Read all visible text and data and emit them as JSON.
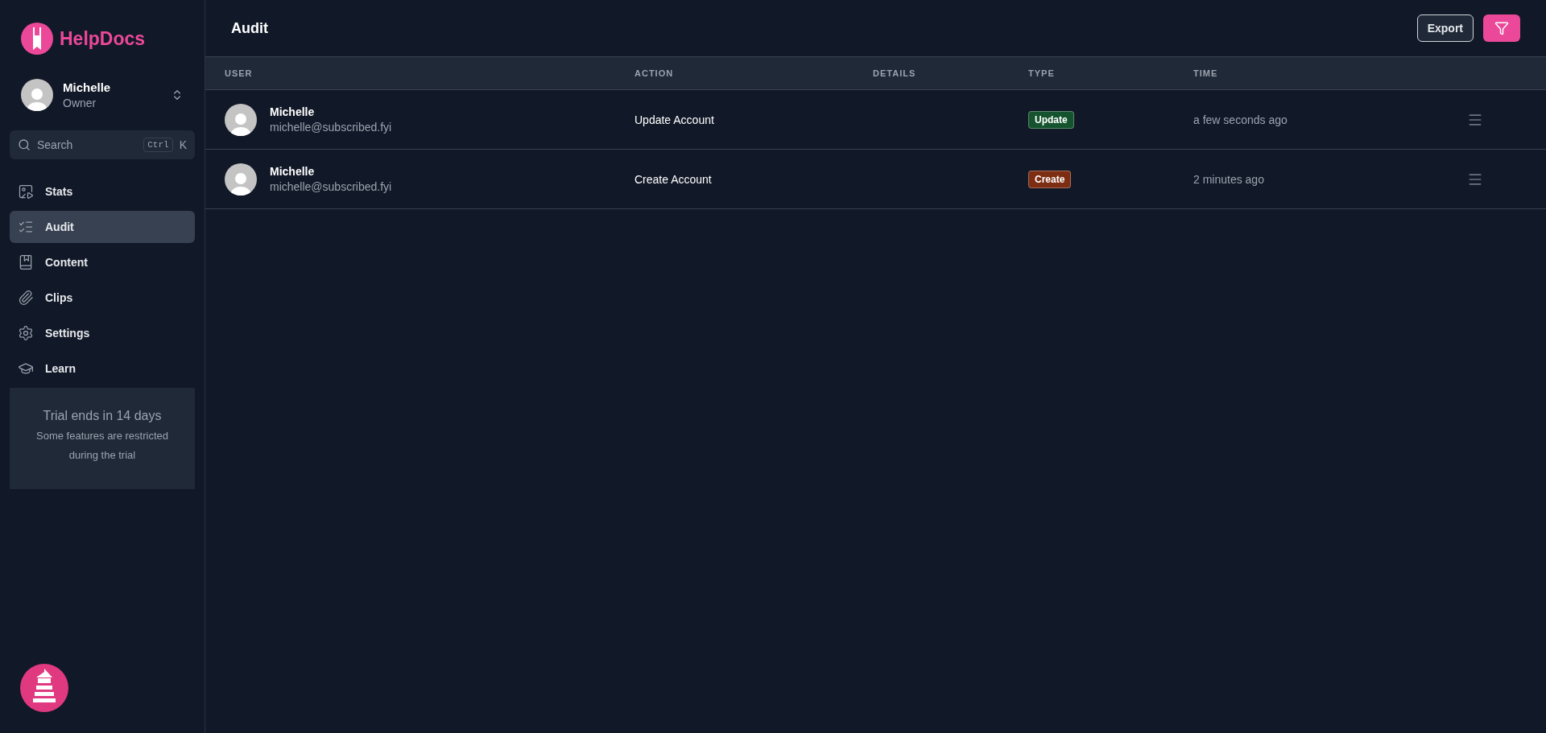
{
  "brand": {
    "name": "HelpDocs"
  },
  "account": {
    "name": "Michelle",
    "role": "Owner"
  },
  "search": {
    "placeholder": "Search",
    "shortcut": [
      "Ctrl",
      "K"
    ]
  },
  "nav": [
    {
      "label": "Stats",
      "selected": false
    },
    {
      "label": "Audit",
      "selected": true
    },
    {
      "label": "Content",
      "selected": false
    },
    {
      "label": "Clips",
      "selected": false
    },
    {
      "label": "Settings",
      "selected": false
    },
    {
      "label": "Learn",
      "selected": false
    }
  ],
  "trial": {
    "title": "Trial ends in 14 days",
    "text": "Some features are restricted during the trial"
  },
  "page": {
    "title": "Audit",
    "export": "Export"
  },
  "table": {
    "columns": [
      "USER",
      "ACTION",
      "DETAILS",
      "TYPE",
      "TIME"
    ],
    "rows": [
      {
        "name": "Michelle",
        "email": "michelle@subscribed.fyi",
        "action": "Update Account",
        "type": "Update",
        "color": "#14532d",
        "time": "a few seconds ago"
      },
      {
        "name": "Michelle",
        "email": "michelle@subscribed.fyi",
        "action": "Create Account",
        "type": "Create",
        "color": "#7c2d12",
        "time": "2 minutes ago"
      }
    ]
  }
}
